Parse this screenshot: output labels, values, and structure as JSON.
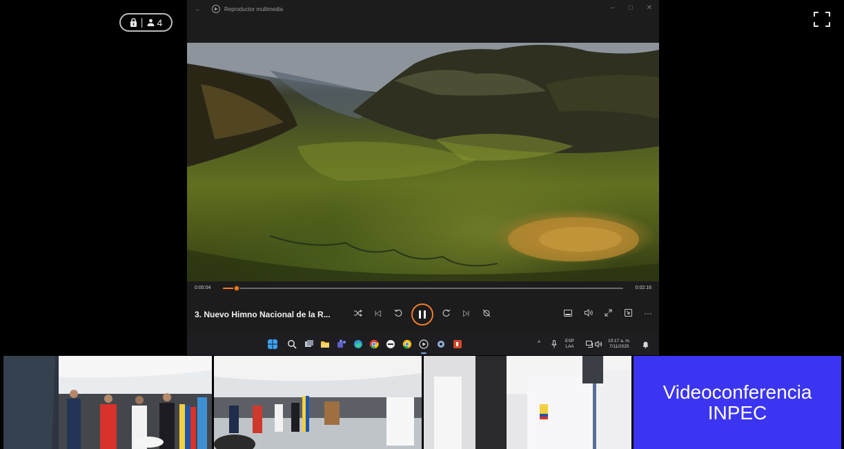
{
  "meeting": {
    "participant_count": "4",
    "lock_icon": "lock-icon",
    "participants_icon": "person-icon",
    "fullscreen_icon": "fullscreen-icon"
  },
  "player": {
    "window_title": "Reproductor multimedia",
    "current_time": "0:00:04",
    "total_time": "0:02:16",
    "progress_fraction": 0.034,
    "now_playing": "3. Nuevo Himno Nacional de la R...",
    "state": "playing",
    "accent_color": "#f07e2a"
  },
  "taskbar": {
    "language_top": "ESP",
    "language_bottom": "LAA",
    "clock_time": "10:17 a. m.",
    "clock_date": "7/11/2025"
  },
  "videoconference": {
    "line1": "Videoconferencia",
    "line2": "INPEC",
    "bg_color": "#3b35f2"
  }
}
